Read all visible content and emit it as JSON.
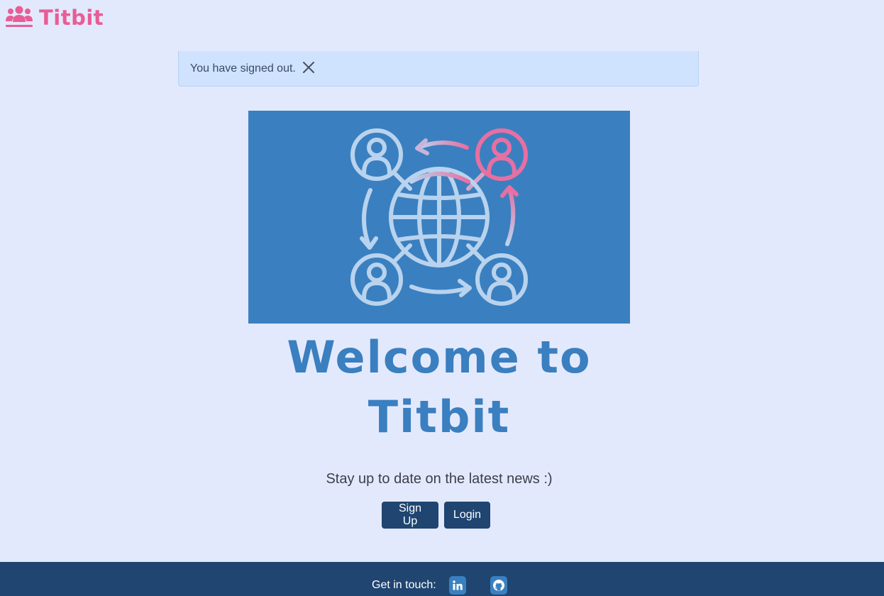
{
  "header": {
    "brand": "Titbit",
    "logo_icon": "users-icon"
  },
  "alert": {
    "message": "You have signed out.",
    "close_icon": "close-icon"
  },
  "hero": {
    "illustration": "global-network-icon"
  },
  "welcome": {
    "line1": "Welcome to",
    "line2": "Titbit"
  },
  "tagline": "Stay up to date on the latest news :)",
  "actions": {
    "signup_label": "Sign Up",
    "login_label": "Login"
  },
  "footer": {
    "get_in_touch": "Get in touch:",
    "links": [
      {
        "icon": "linkedin-icon"
      },
      {
        "icon": "github-icon"
      }
    ]
  },
  "colors": {
    "background": "#e3e9fc",
    "brand_pink": "#e85d97",
    "primary_blue": "#3a80c0",
    "navy": "#1f4570",
    "alert_bg": "#cfe2fe"
  }
}
